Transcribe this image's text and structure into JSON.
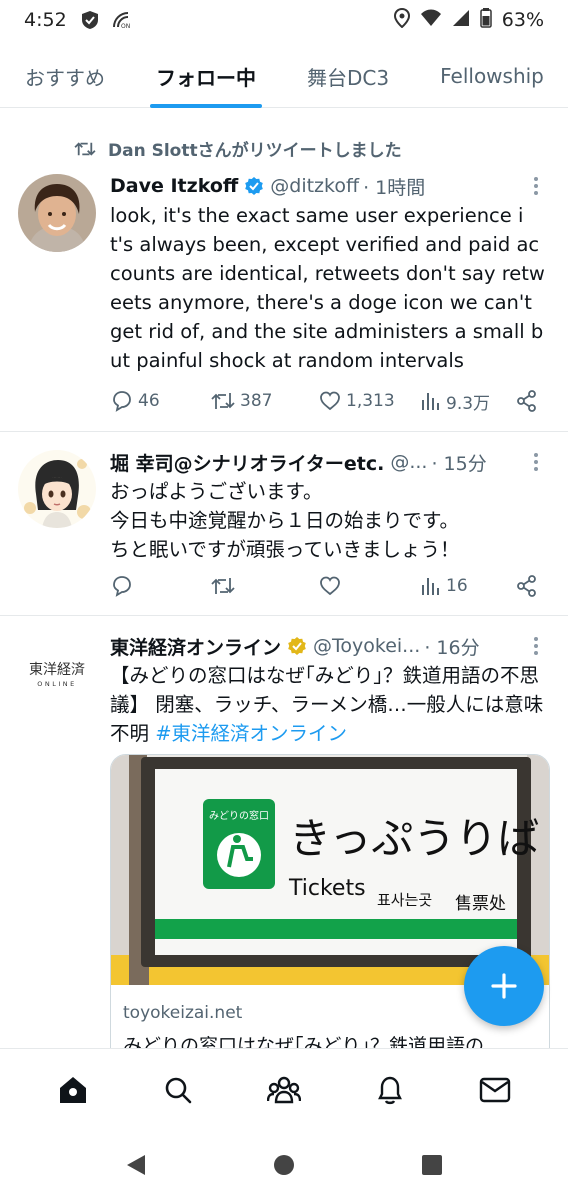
{
  "status_bar": {
    "time": "4:52",
    "battery": "63%"
  },
  "tabs": [
    {
      "label": "おすすめ",
      "active": false
    },
    {
      "label": "フォロー中",
      "active": true
    },
    {
      "label": "舞台DC3",
      "active": false
    },
    {
      "label": "Fellowship",
      "active": false
    }
  ],
  "tweets": [
    {
      "retweeted_by": "Dan Slottさんがリツイートしました",
      "name": "Dave Itzkoff",
      "verified_color": "#1d9bf0",
      "handle": "@ditzkoff",
      "time": "· 1時間",
      "text": "look, it's the exact same user experience it's always been, except verified and paid accounts are identical, retweets don't say retweets anymore, there's a doge icon we can't get rid of, and the site administers a small but painful shock at random intervals",
      "replies": "46",
      "retweets": "387",
      "likes": "1,313",
      "views": "9.3万"
    },
    {
      "name": "堀 幸司@シナリオライターetc.",
      "handle": "@...",
      "time": "· 15分",
      "text": "おっぱようございます。\n今日も中途覚醒から１日の始まりです。\nちと眠いですが頑張っていきましょう！",
      "views": "16"
    },
    {
      "name": "東洋経済オンライン",
      "verified_color": "#e2b719",
      "handle": "@Toyokei...",
      "time": "· 16分",
      "text": "【みどりの窓口はなぜ｢みどり｣？鉄道用語の不思議】 閉塞、ラッチ、ラーメン橋…一般人には意味不明 ",
      "hashtag": "#東洋経済オンライン",
      "avatar_logo_top": "東洋経済",
      "avatar_logo_bottom": "ONLINE",
      "card": {
        "domain": "toyokeizai.net",
        "title": "みどりの窓口はなぜ｢みどり｣？鉄道用語の",
        "sign_small": "みどりの窓口",
        "sign_main": "きっぷうりば",
        "sign_en": "Tickets",
        "sign_ko": "표사는곳",
        "sign_zh": "售票处"
      }
    }
  ],
  "colors": {
    "accent": "#1d9bf0",
    "text": "#0f1419",
    "muted": "#536471"
  }
}
